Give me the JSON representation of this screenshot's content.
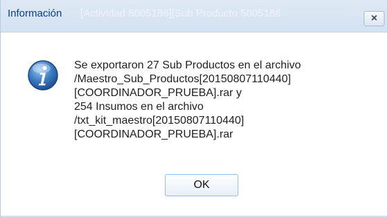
{
  "dialog": {
    "title": "Información",
    "background_title": "[Actividad 5005186][Sub Producto 5005186",
    "close_symbol": "×",
    "icon": "info-icon",
    "message_lines": [
      "Se exportaron 27 Sub Productos en el archivo",
      "/Maestro_Sub_Productos[20150807110440]",
      "[COORDINADOR_PRUEBA].rar y",
      "254 Insumos en el archivo",
      "/txt_kit_maestro[20150807110440]",
      "[COORDINADOR_PRUEBA].rar"
    ],
    "ok_label": "OK"
  },
  "colors": {
    "title_text": "#04408c",
    "titlebar_bg": "#d3e1f1",
    "icon_blue": "#2f6db5",
    "button_border": "#99bbe8"
  }
}
